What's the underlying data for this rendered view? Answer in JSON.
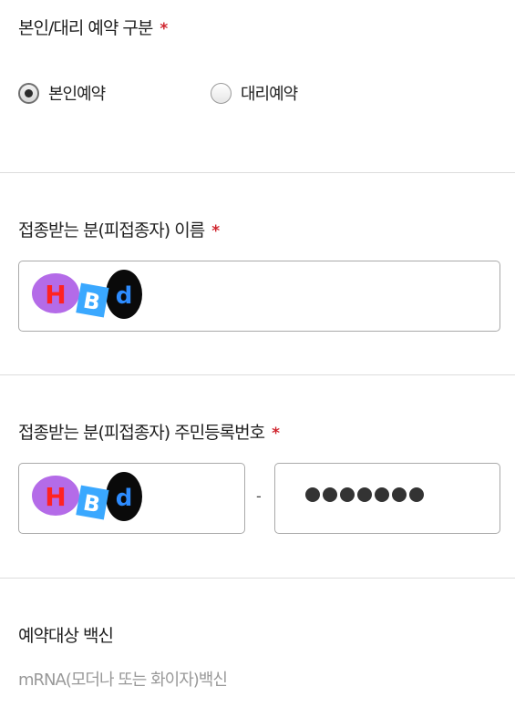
{
  "booking_type": {
    "label": "본인/대리 예약 구분",
    "required_mark": "*",
    "options": [
      {
        "label": "본인예약",
        "checked": true
      },
      {
        "label": "대리예약",
        "checked": false
      }
    ]
  },
  "recipient_name": {
    "label": "접종받는 분(피접종자) 이름",
    "required_mark": "*",
    "value_sticker": "hbd-sticker-icon"
  },
  "resident_number": {
    "label": "접종받는 분(피접종자) 주민등록번호",
    "required_mark": "*",
    "separator": "-",
    "front_sticker": "hbd-sticker-icon",
    "masked_count": 7
  },
  "vaccine": {
    "label": "예약대상 백신",
    "value": "mRNA(모더나 또는 화이자)백신"
  },
  "colors": {
    "required": "#d0262f",
    "border": "#a9a9a9",
    "divider": "#dddddd",
    "muted_text": "#999999"
  }
}
